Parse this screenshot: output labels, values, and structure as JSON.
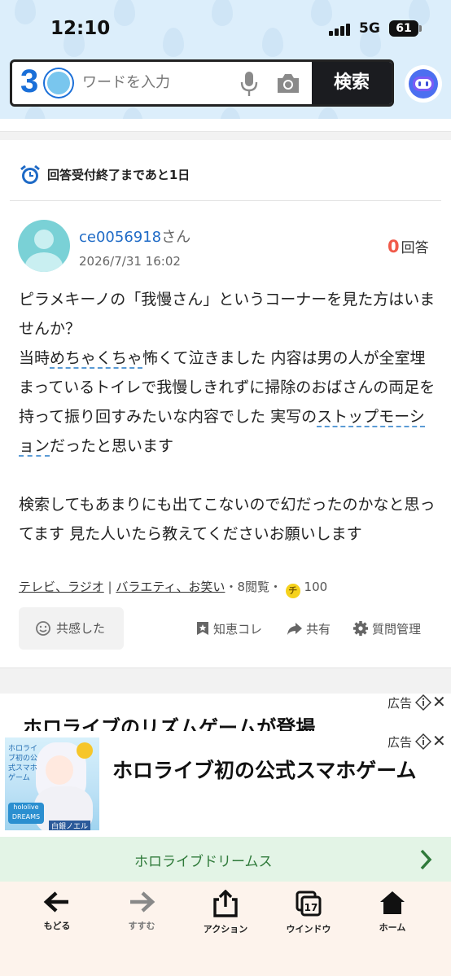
{
  "status_bar": {
    "time": "12:10",
    "network": "5G",
    "battery": "61"
  },
  "search": {
    "logo_text": "3",
    "placeholder": "ワードを入力",
    "button_label": "検索"
  },
  "deadline": {
    "text": "回答受付終了まであと1日"
  },
  "question": {
    "user": "ce0056918",
    "user_suffix": "さん",
    "date": "2026/7/31 16:02",
    "answer_count": "0",
    "answer_label": "回答",
    "body": {
      "p1": "ピラメキーノの「我慢さん」というコーナーを見た方はいませんか？",
      "p2a": "当時",
      "p2b": "めちゃくちゃ",
      "p2c": "怖くて泣きました 内容は男の人が全室埋まっているトイレで我慢しきれずに掃除のおばさんの両足を持って振り回すみたいな内容でした 実写の",
      "p2d": "ストップモーション",
      "p2e": "だったと思います",
      "p3": "検索してもあまりにも出てこないので幻だったのかなと思ってます 見た人いたら教えてくださいお願いします"
    },
    "category1": "テレビ、ラジオ",
    "category_sep": "|",
    "category2": "バラエティ、お笑い",
    "views": "・8閲覧・",
    "coin_label": "チ",
    "coins": "100"
  },
  "actions": {
    "empathy": "共感した",
    "save": "知恵コレ",
    "share": "共有",
    "manage": "質問管理"
  },
  "ads": [
    {
      "label": "広告",
      "title": "ホロライブのリズムゲームが登場"
    },
    {
      "label": "広告",
      "title": "ホロライブ初の公式スマホゲーム",
      "cta": "ホロライブドリームス",
      "image_text": "ホロライブ初の公式スマホゲーム",
      "image_badge": "hololive DREAMS",
      "image_name": "白銀ノエル"
    }
  ],
  "bottom_nav": [
    {
      "label": "もどる",
      "icon": "back-arrow-icon"
    },
    {
      "label": "すすむ",
      "icon": "forward-arrow-icon"
    },
    {
      "label": "アクション",
      "icon": "share-icon"
    },
    {
      "label": "ウインドウ",
      "icon": "windows-icon",
      "count": "17"
    },
    {
      "label": "ホーム",
      "icon": "home-icon"
    }
  ],
  "colors": {
    "accent": "#1e6ac6",
    "answer_count": "#f05a4a",
    "search_button": "#1b1c20",
    "cta_bar": "#e3f4e6",
    "nav_bg": "#fdf3ec"
  }
}
